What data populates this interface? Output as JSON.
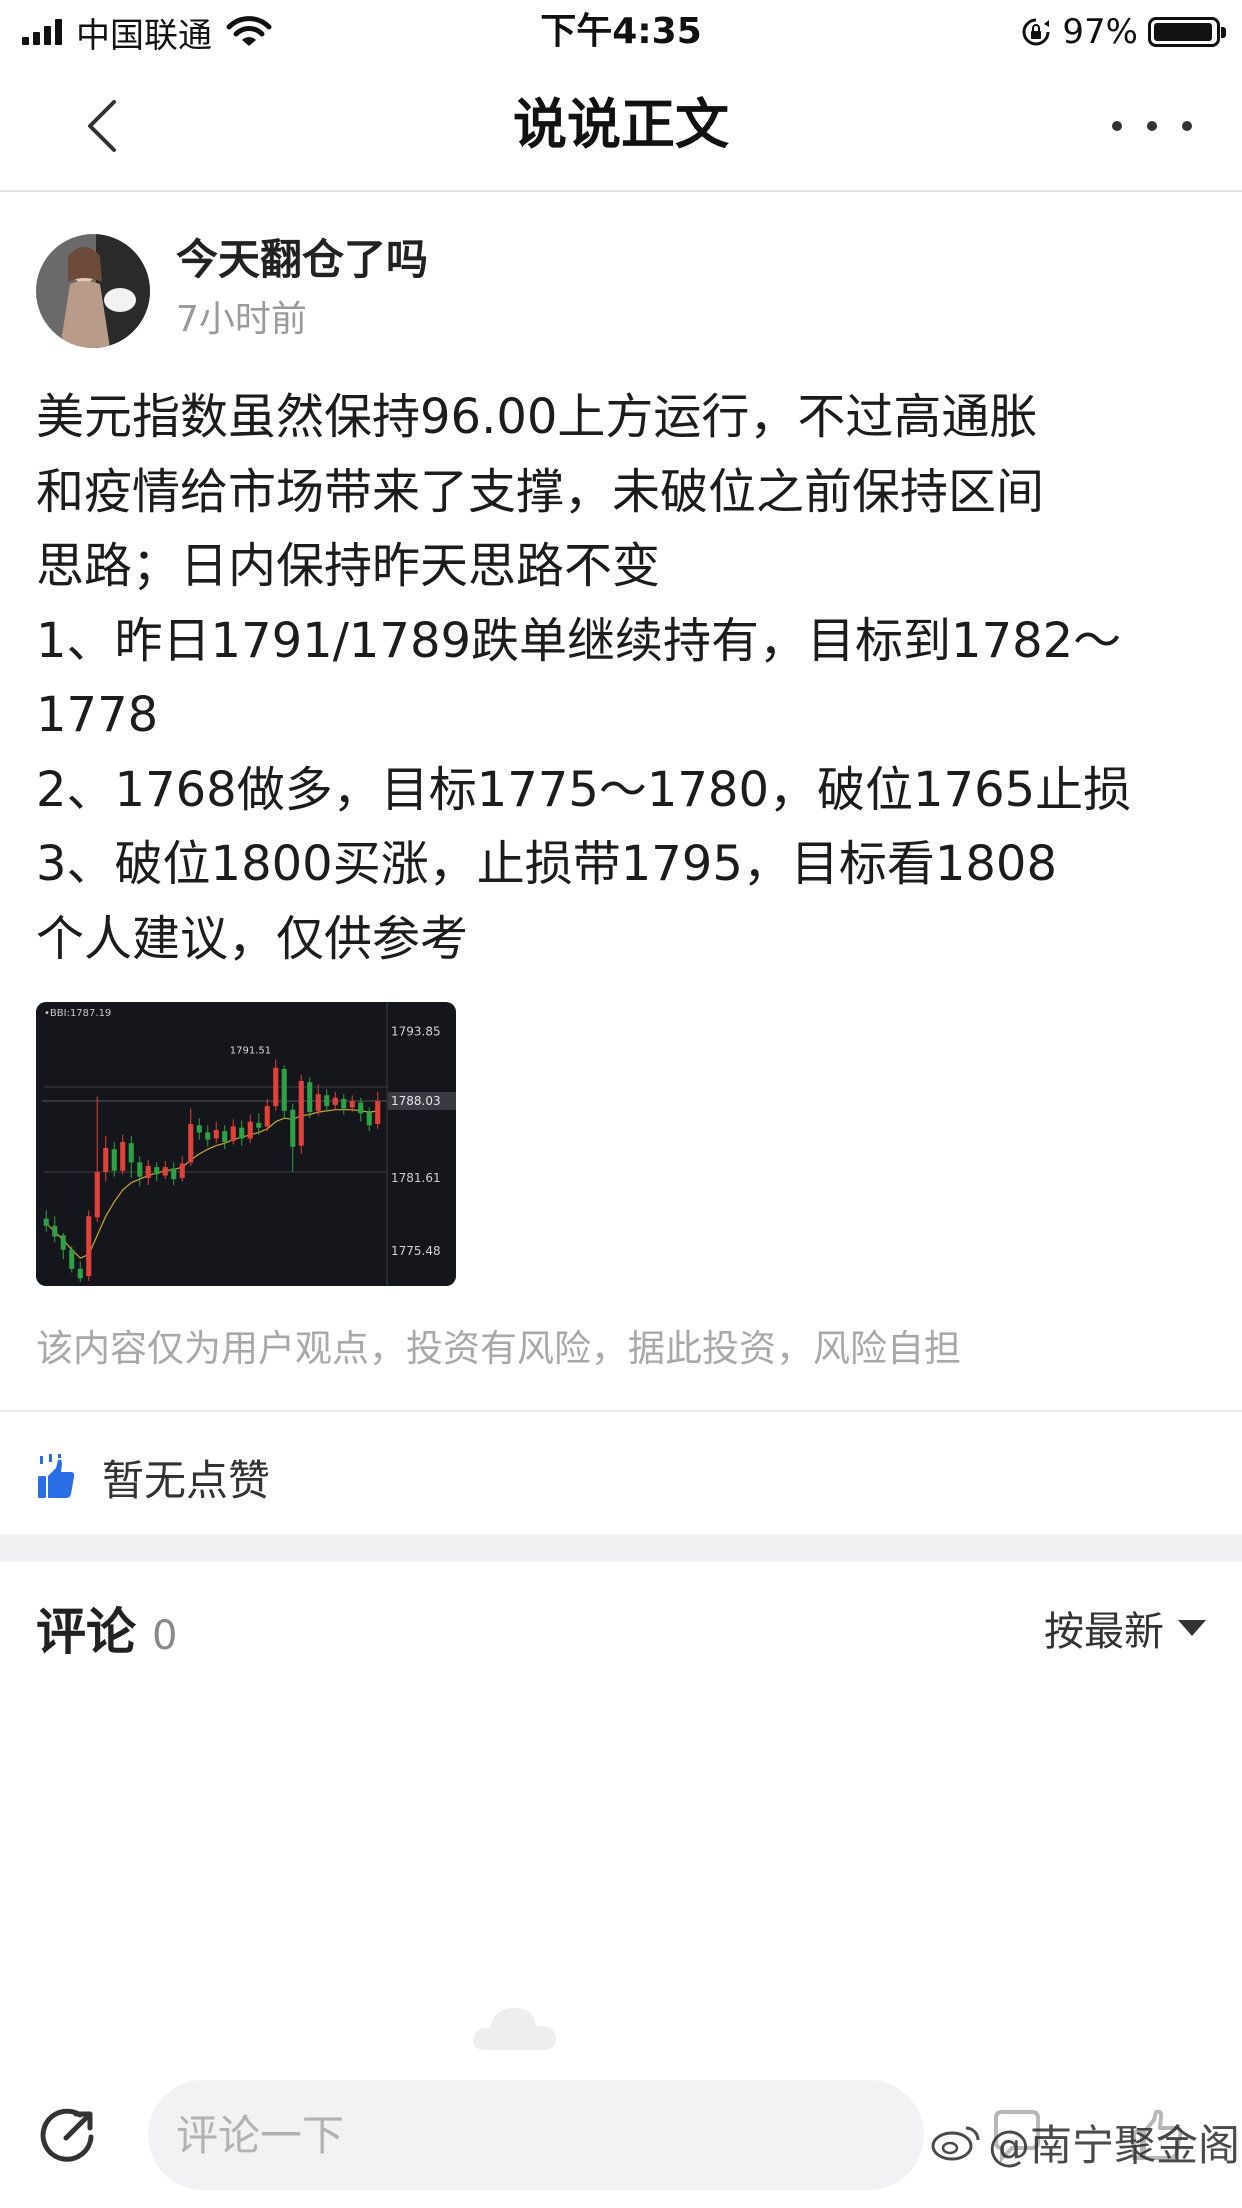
{
  "status_bar": {
    "carrier": "中国联通",
    "time": "下午4:35",
    "battery_percent": "97%"
  },
  "nav": {
    "title": "说说正文",
    "back_icon": "chevron-left-icon",
    "more_icon": "more-dots-icon"
  },
  "post": {
    "author": "今天翻仓了吗",
    "time": "7小时前",
    "content_lines": [
      "美元指数虽然保持96.00上方运行，不过高通胀",
      "和疫情给市场带来了支撑，未破位之前保持区间",
      "思路；日内保持昨天思路不变",
      "1、昨日1791/1789跌单继续持有，目标到1782～",
      "1778",
      "2、1768做多，目标1775～1780，破位1765止损",
      "3、破位1800买涨，止损带1795，目标看1808",
      "个人建议，仅供参考"
    ],
    "disclaimer": "该内容仅为用户观点，投资有风险，据此投资，风险自担"
  },
  "chart_data": {
    "type": "candlestick",
    "indicator_label": "•BBI:1787.19",
    "peak_label": "1791.51",
    "y_tick_labels": [
      "1793.85",
      "1788.03",
      "1781.61",
      "1775.48"
    ],
    "ylim": [
      1772.9,
      1795.8
    ],
    "current_price": 1788.03,
    "up_color": "#e0413a",
    "down_color": "#2ea045",
    "candles": [
      [
        1778.2,
        1777.6,
        1778.9,
        1777.1
      ],
      [
        1777.6,
        1776.7,
        1778.4,
        1776.2
      ],
      [
        1776.8,
        1775.6,
        1777.0,
        1774.8
      ],
      [
        1775.6,
        1774.0,
        1775.9,
        1773.7
      ],
      [
        1774.0,
        1773.2,
        1774.6,
        1772.9
      ],
      [
        1773.4,
        1778.4,
        1778.9,
        1773.0
      ],
      [
        1778.3,
        1782.1,
        1788.4,
        1777.9
      ],
      [
        1782.1,
        1784.1,
        1785.1,
        1781.3
      ],
      [
        1784.0,
        1782.2,
        1784.6,
        1781.7
      ],
      [
        1782.2,
        1784.6,
        1785.2,
        1781.9
      ],
      [
        1784.5,
        1782.9,
        1785.1,
        1781.6
      ],
      [
        1782.9,
        1781.7,
        1783.4,
        1780.9
      ],
      [
        1781.6,
        1782.6,
        1783.1,
        1781.0
      ],
      [
        1782.5,
        1781.9,
        1782.9,
        1781.3
      ],
      [
        1781.8,
        1782.5,
        1783.0,
        1781.5
      ],
      [
        1782.4,
        1781.5,
        1782.9,
        1781.0
      ],
      [
        1781.6,
        1782.8,
        1783.4,
        1781.3
      ],
      [
        1782.9,
        1786.1,
        1787.4,
        1782.6
      ],
      [
        1786.0,
        1785.4,
        1786.6,
        1784.8
      ],
      [
        1785.4,
        1784.8,
        1786.0,
        1784.2
      ],
      [
        1784.9,
        1785.6,
        1786.3,
        1784.5
      ],
      [
        1785.5,
        1784.6,
        1786.0,
        1784.0
      ],
      [
        1784.7,
        1785.9,
        1786.5,
        1784.4
      ],
      [
        1785.8,
        1784.9,
        1786.4,
        1784.3
      ],
      [
        1784.9,
        1786.3,
        1786.9,
        1784.5
      ],
      [
        1786.2,
        1785.8,
        1787.0,
        1785.2
      ],
      [
        1785.9,
        1787.6,
        1788.2,
        1785.5
      ],
      [
        1787.6,
        1790.8,
        1791.5,
        1787.2
      ],
      [
        1790.7,
        1787.2,
        1791.0,
        1786.5
      ],
      [
        1787.3,
        1784.2,
        1787.8,
        1782.1
      ],
      [
        1784.3,
        1789.7,
        1790.2,
        1783.6
      ],
      [
        1789.6,
        1787.1,
        1790.0,
        1786.6
      ],
      [
        1787.2,
        1788.6,
        1789.4,
        1786.8
      ],
      [
        1788.5,
        1787.6,
        1789.0,
        1787.1
      ],
      [
        1787.7,
        1788.3,
        1788.8,
        1787.3
      ],
      [
        1788.2,
        1787.4,
        1788.6,
        1786.9
      ],
      [
        1787.5,
        1788.0,
        1788.5,
        1787.1
      ],
      [
        1787.9,
        1787.0,
        1788.3,
        1786.3
      ],
      [
        1787.1,
        1786.0,
        1787.5,
        1785.5
      ],
      [
        1786.1,
        1788.0,
        1788.8,
        1785.7
      ]
    ],
    "bbi": [
      1777.8,
      1777.1,
      1776.4,
      1775.6,
      1774.9,
      1775.2,
      1776.8,
      1778.4,
      1779.6,
      1780.6,
      1781.2,
      1781.5,
      1781.8,
      1782.0,
      1782.2,
      1782.3,
      1782.5,
      1783.1,
      1783.6,
      1784.0,
      1784.3,
      1784.5,
      1784.8,
      1785.0,
      1785.2,
      1785.4,
      1785.7,
      1786.3,
      1786.6,
      1786.5,
      1786.8,
      1786.9,
      1787.1,
      1787.2,
      1787.3,
      1787.3,
      1787.3,
      1787.2,
      1787.1,
      1787.19
    ]
  },
  "likes": {
    "icon": "thumbs-up-icon",
    "text": "暂无点赞"
  },
  "comments": {
    "title": "评论",
    "count": "0",
    "sort_label": "按最新"
  },
  "bottom_bar": {
    "share_icon": "share-icon",
    "input_placeholder": "评论一下",
    "watermark": "@南宁聚金阁"
  }
}
